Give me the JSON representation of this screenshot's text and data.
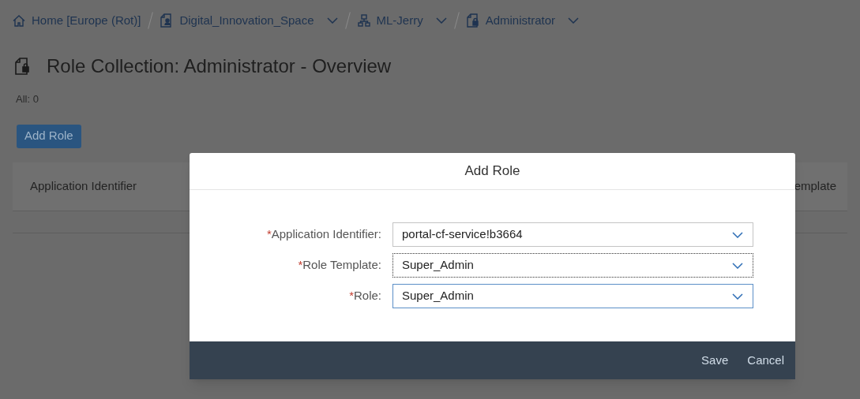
{
  "breadcrumbs": [
    {
      "label": "Home [Europe (Rot)]",
      "kind": "home",
      "dropdown": false
    },
    {
      "label": "Digital_Innovation_Space",
      "kind": "space",
      "dropdown": true
    },
    {
      "label": "ML-Jerry",
      "kind": "hierarchy",
      "dropdown": true
    },
    {
      "label": "Administrator",
      "kind": "collection",
      "dropdown": true
    }
  ],
  "page": {
    "title": "Role Collection: Administrator - Overview",
    "count": "All: 0",
    "add_button": "Add Role"
  },
  "table": {
    "columns": [
      "Application Identifier",
      "emplate"
    ]
  },
  "dialog": {
    "title": "Add Role",
    "fields": [
      {
        "marker": "*",
        "label": "Application Identifier:",
        "value": "portal-cf-service!b3664",
        "focused": false,
        "selected": false
      },
      {
        "marker": "*",
        "label": "Role Template:",
        "value": "Super_Admin",
        "focused": true,
        "selected": false
      },
      {
        "marker": "*",
        "label": "Role:",
        "value": "Super_Admin",
        "focused": false,
        "selected": true
      }
    ],
    "buttons": [
      "Save",
      "Cancel"
    ]
  }
}
